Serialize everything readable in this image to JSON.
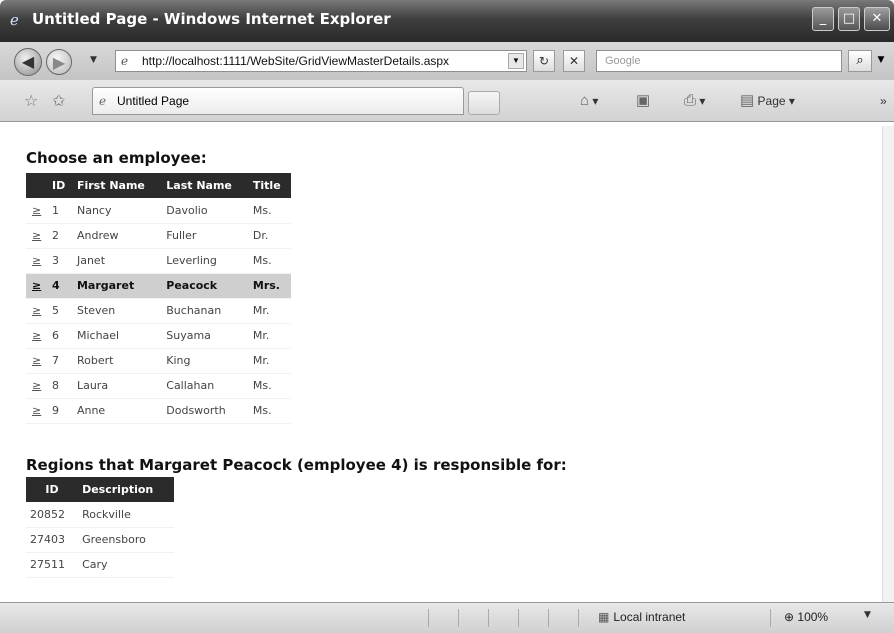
{
  "window": {
    "title": "Untitled Page - Windows Internet Explorer",
    "minimize": "_",
    "maximize": "□",
    "close": "✕"
  },
  "address": {
    "url": "http://localhost:1111/WebSite/GridViewMasterDetails.aspx",
    "refresh": "↻",
    "stop": "✕",
    "search_placeholder": "Google",
    "search_icon": "⌕"
  },
  "tabs": {
    "active_tab": "Untitled Page",
    "page_menu": "Page"
  },
  "employees": {
    "heading": "Choose an employee:",
    "columns": [
      "ID",
      "First Name",
      "Last Name",
      "Title"
    ],
    "select_text": "≥",
    "selected_id": 4,
    "rows": [
      {
        "id": "1",
        "first": "Nancy",
        "last": "Davolio",
        "title": "Ms."
      },
      {
        "id": "2",
        "first": "Andrew",
        "last": "Fuller",
        "title": "Dr."
      },
      {
        "id": "3",
        "first": "Janet",
        "last": "Leverling",
        "title": "Ms."
      },
      {
        "id": "4",
        "first": "Margaret",
        "last": "Peacock",
        "title": "Mrs."
      },
      {
        "id": "5",
        "first": "Steven",
        "last": "Buchanan",
        "title": "Mr."
      },
      {
        "id": "6",
        "first": "Michael",
        "last": "Suyama",
        "title": "Mr."
      },
      {
        "id": "7",
        "first": "Robert",
        "last": "King",
        "title": "Mr."
      },
      {
        "id": "8",
        "first": "Laura",
        "last": "Callahan",
        "title": "Ms."
      },
      {
        "id": "9",
        "first": "Anne",
        "last": "Dodsworth",
        "title": "Ms."
      }
    ]
  },
  "regions": {
    "heading": "Regions that Margaret Peacock (employee 4) is responsible for:",
    "columns": [
      "ID",
      "Description"
    ],
    "rows": [
      {
        "id": "20852",
        "description": "Rockville"
      },
      {
        "id": "27403",
        "description": "Greensboro"
      },
      {
        "id": "27511",
        "description": "Cary"
      }
    ]
  },
  "status": {
    "zone": "Local intranet",
    "zoom": "100%"
  },
  "colors": {
    "header_bg": "#2b2b2b",
    "selected_row_bg": "#cfcfcf"
  }
}
